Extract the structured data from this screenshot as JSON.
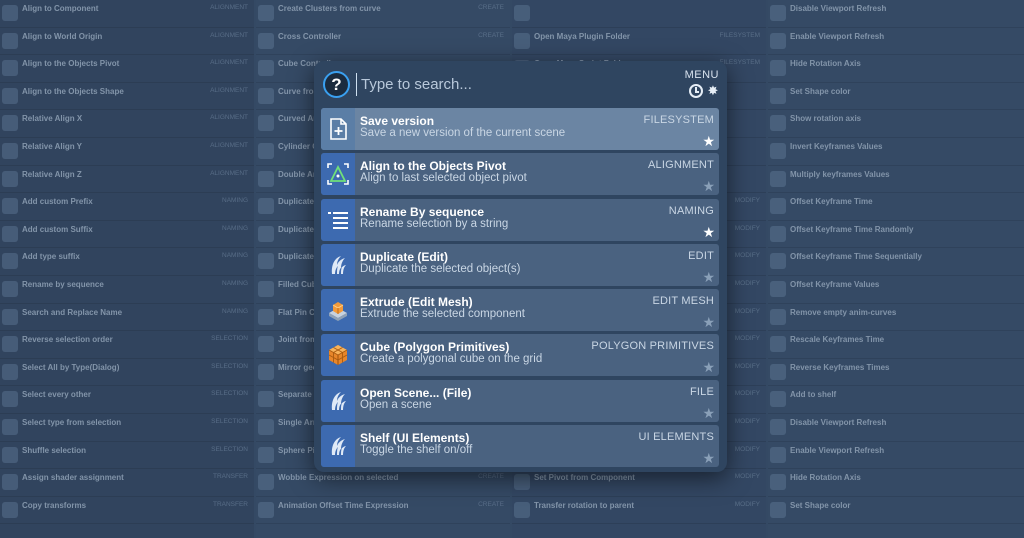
{
  "search": {
    "placeholder": "Type to search..."
  },
  "header": {
    "help_label": "?",
    "menu_label": "MENU"
  },
  "results": [
    {
      "title": "Save version",
      "desc": "Save a new version of the current scene",
      "category": "FILESYSTEM",
      "favorite": true,
      "selected": true,
      "icon": "save-version-icon"
    },
    {
      "title": "Align to the Objects Pivot",
      "desc": "Align to last selected object pivot",
      "category": "ALIGNMENT",
      "favorite": false,
      "selected": false,
      "icon": "align-pivot-icon"
    },
    {
      "title": "Rename By sequence",
      "desc": "Rename selection by a string",
      "category": "NAMING",
      "favorite": true,
      "selected": false,
      "icon": "rename-sequence-icon"
    },
    {
      "title": "Duplicate (Edit)",
      "desc": "Duplicate the selected object(s)",
      "category": "EDIT",
      "favorite": false,
      "selected": false,
      "icon": "maya-logo-icon"
    },
    {
      "title": "Extrude (Edit Mesh)",
      "desc": "Extrude the selected component",
      "category": "EDIT MESH",
      "favorite": false,
      "selected": false,
      "icon": "extrude-icon"
    },
    {
      "title": "Cube (Polygon Primitives)",
      "desc": "Create a polygonal cube on the grid",
      "category": "POLYGON PRIMITIVES",
      "favorite": false,
      "selected": false,
      "icon": "poly-cube-icon"
    },
    {
      "title": "Open Scene... (File)",
      "desc": "Open a scene",
      "category": "FILE",
      "favorite": false,
      "selected": false,
      "icon": "maya-logo-icon"
    },
    {
      "title": "Shelf (UI Elements)",
      "desc": "Toggle the shelf on/off",
      "category": "UI ELEMENTS",
      "favorite": false,
      "selected": false,
      "icon": "maya-logo-icon"
    }
  ],
  "background": {
    "col1": [
      {
        "t": "Align to Component",
        "c": "ALIGNMENT"
      },
      {
        "t": "Align to World Origin",
        "c": "ALIGNMENT"
      },
      {
        "t": "Align to the Objects Pivot",
        "c": "ALIGNMENT"
      },
      {
        "t": "Align to the Objects Shape",
        "c": "ALIGNMENT"
      },
      {
        "t": "Relative Align X",
        "c": "ALIGNMENT"
      },
      {
        "t": "Relative Align Y",
        "c": "ALIGNMENT"
      },
      {
        "t": "Relative Align Z",
        "c": "ALIGNMENT"
      },
      {
        "t": "Add custom Prefix",
        "c": "NAMING"
      },
      {
        "t": "Add custom Suffix",
        "c": "NAMING"
      },
      {
        "t": "Add type suffix",
        "c": "NAMING"
      },
      {
        "t": "Rename by sequence",
        "c": "NAMING"
      },
      {
        "t": "Search and Replace Name",
        "c": "NAMING"
      },
      {
        "t": "Reverse selection order",
        "c": "SELECTION"
      },
      {
        "t": "Select All by Type(Dialog)",
        "c": "SELECTION"
      },
      {
        "t": "Select every other",
        "c": "SELECTION"
      },
      {
        "t": "Select type from selection",
        "c": "SELECTION"
      },
      {
        "t": "Shuffle selection",
        "c": "SELECTION"
      },
      {
        "t": "Assign shader assignment",
        "c": "TRANSFER"
      },
      {
        "t": "Copy transforms",
        "c": "TRANSFER"
      }
    ],
    "col2": [
      {
        "t": "Create Clusters from curve",
        "c": "CREATE"
      },
      {
        "t": "Cross Controller",
        "c": "CREATE"
      },
      {
        "t": "Cube Controller",
        "c": ""
      },
      {
        "t": "Curve from",
        "c": ""
      },
      {
        "t": "Curved Arrow",
        "c": ""
      },
      {
        "t": "Cylinder Controller",
        "c": ""
      },
      {
        "t": "Double Arrow",
        "c": ""
      },
      {
        "t": "Duplicate",
        "c": ""
      },
      {
        "t": "Duplicate",
        "c": ""
      },
      {
        "t": "Duplicate",
        "c": ""
      },
      {
        "t": "Filled Cube",
        "c": ""
      },
      {
        "t": "Flat Pin Controller",
        "c": ""
      },
      {
        "t": "Joint from",
        "c": ""
      },
      {
        "t": "Mirror geometry",
        "c": ""
      },
      {
        "t": "Separate",
        "c": ""
      },
      {
        "t": "Single Arrow",
        "c": ""
      },
      {
        "t": "Sphere Pin",
        "c": ""
      },
      {
        "t": "Wobble Expression on selected",
        "c": "CREATE"
      },
      {
        "t": "Animation Offset Time Expression",
        "c": "CREATE"
      }
    ],
    "col3": [
      {
        "t": "",
        "c": ""
      },
      {
        "t": "Open Maya Plugin Folder",
        "c": "FILESYSTEM"
      },
      {
        "t": "Open Maya Script Folder",
        "c": "FILESYSTEM"
      },
      {
        "t": "",
        "c": ""
      },
      {
        "t": "",
        "c": ""
      },
      {
        "t": "",
        "c": ""
      },
      {
        "t": "",
        "c": ""
      },
      {
        "t": "",
        "c": "MODIFY"
      },
      {
        "t": "",
        "c": "MODIFY"
      },
      {
        "t": "",
        "c": "MODIFY"
      },
      {
        "t": "",
        "c": "MODIFY"
      },
      {
        "t": "",
        "c": "MODIFY"
      },
      {
        "t": "",
        "c": "MODIFY"
      },
      {
        "t": "",
        "c": "MODIFY"
      },
      {
        "t": "",
        "c": "MODIFY"
      },
      {
        "t": "",
        "c": "MODIFY"
      },
      {
        "t": "",
        "c": "MODIFY"
      },
      {
        "t": "Set Pivot from Component",
        "c": "MODIFY"
      },
      {
        "t": "Transfer rotation to parent",
        "c": "MODIFY"
      }
    ],
    "col4": [
      {
        "t": "Disable Viewport Refresh",
        "c": ""
      },
      {
        "t": "Enable Viewport Refresh",
        "c": ""
      },
      {
        "t": "Hide Rotation Axis",
        "c": ""
      },
      {
        "t": "Set Shape color",
        "c": ""
      },
      {
        "t": "Show rotation axis",
        "c": ""
      },
      {
        "t": "Invert Keyframes Values",
        "c": ""
      },
      {
        "t": "Multiply keyframes Values",
        "c": ""
      },
      {
        "t": "Offset Keyframe Time",
        "c": ""
      },
      {
        "t": "Offset Keyframe Time Randomly",
        "c": ""
      },
      {
        "t": "Offset Keyframe Time Sequentially",
        "c": ""
      },
      {
        "t": "Offset Keyframe Values",
        "c": ""
      },
      {
        "t": "Remove empty anim-curves",
        "c": ""
      },
      {
        "t": "Rescale Keyframes Time",
        "c": ""
      },
      {
        "t": "Reverse Keyframes Times",
        "c": ""
      },
      {
        "t": "Add to shelf",
        "c": ""
      },
      {
        "t": "Disable Viewport Refresh",
        "c": ""
      },
      {
        "t": "Enable Viewport Refresh",
        "c": ""
      },
      {
        "t": "Hide Rotation Axis",
        "c": ""
      },
      {
        "t": "Set Shape color",
        "c": ""
      }
    ]
  },
  "colors": {
    "accent": "#3aa0f0",
    "panel": "#2f4560",
    "item": "#4a6280",
    "item_selected": "#6b85a3",
    "icon_tile": "#3d6ab0"
  }
}
